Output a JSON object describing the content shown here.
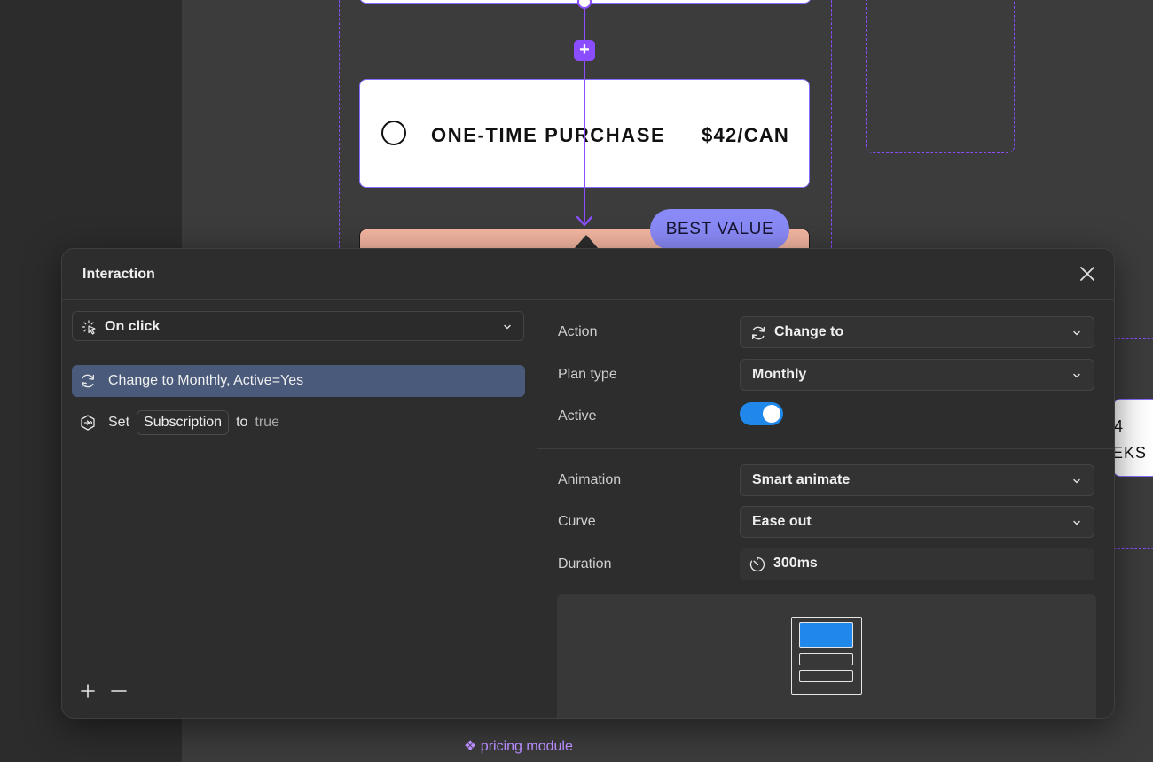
{
  "canvas": {
    "card_title": "ONE-TIME PURCHASE",
    "card_price": "$42/CAN",
    "badge": "BEST VALUE",
    "side_card_line1": "4",
    "side_card_line2": "EKS",
    "module_label": "❖ pricing module"
  },
  "panel": {
    "title": "Interaction",
    "trigger": {
      "label": "On click"
    },
    "items": [
      {
        "label": "Change to Monthly, Active=Yes"
      },
      {
        "prefix": "Set",
        "variable": "Subscription",
        "middle": "to",
        "value": "true"
      }
    ],
    "footer": {
      "add": "+",
      "remove": "—"
    },
    "properties": {
      "action": {
        "key": "Action",
        "value": "Change to"
      },
      "plan_type": {
        "key": "Plan type",
        "value": "Monthly"
      },
      "active": {
        "key": "Active",
        "on": true
      },
      "animation": {
        "key": "Animation",
        "value": "Smart animate"
      },
      "curve": {
        "key": "Curve",
        "value": "Ease out"
      },
      "duration": {
        "key": "Duration",
        "value": "300ms"
      }
    }
  },
  "colors": {
    "accent": "#8a4dff",
    "selected_item": "#4a5a7a",
    "toggle_on": "#1f88ea",
    "badge": "#8a8af7",
    "peach_card": "#f4b6a1"
  }
}
